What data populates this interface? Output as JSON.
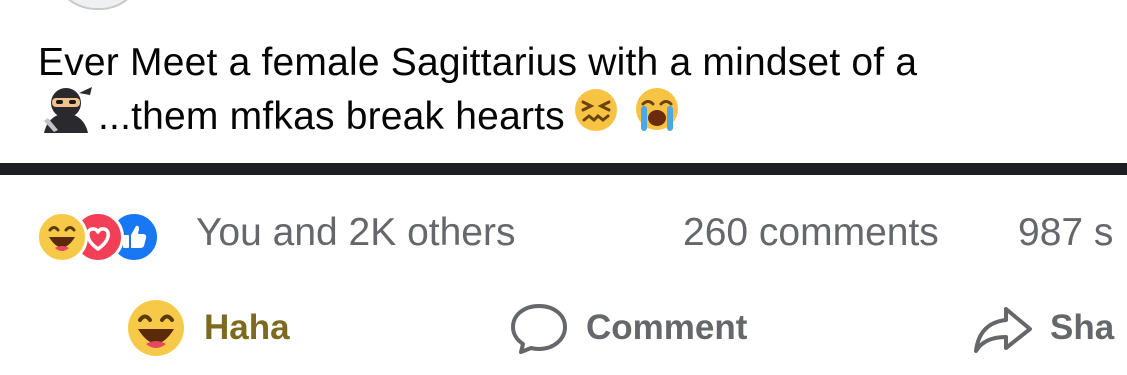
{
  "post": {
    "text_line1": "Ever Meet a female Sagittarius with a mindset of a",
    "text_line2_prefix_emoji": "ninja",
    "text_line2": "...them mfkas break hearts",
    "text_line2_suffix_emojis": [
      "confounded-face",
      "loudly-crying-face"
    ]
  },
  "reactions": {
    "icons": [
      "haha-reaction-icon",
      "love-reaction-icon",
      "like-reaction-icon"
    ],
    "summary": "You and 2K others",
    "comments": "260 comments",
    "shares": "987 s"
  },
  "actions": {
    "haha_label": "Haha",
    "comment_label": "Comment",
    "share_label": "Sha"
  },
  "colors": {
    "haha_active": "#7d6a1f",
    "secondary_text": "#65676b",
    "love": "#f33e58",
    "like": "#1877f2",
    "haha_yellow": "#f7c948",
    "divider": "#1c1e21"
  }
}
